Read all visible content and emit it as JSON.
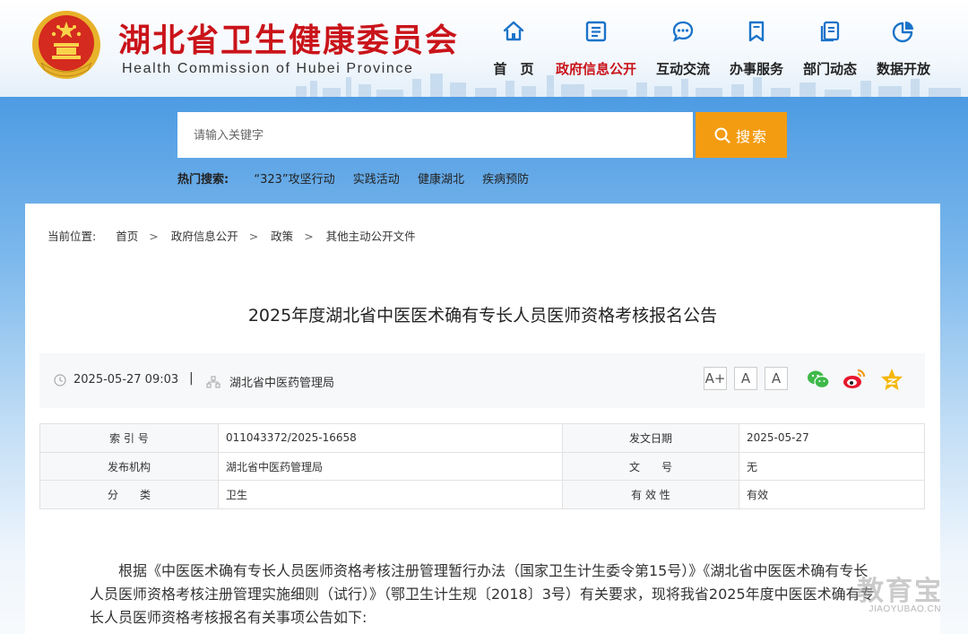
{
  "header": {
    "title": "湖北省卫生健康委员会",
    "subtitle": "Health Commission of Hubei Province"
  },
  "nav": [
    {
      "label": "首　页",
      "icon": "home-icon"
    },
    {
      "label": "政府信息公开",
      "icon": "document-list-icon",
      "active": true
    },
    {
      "label": "互动交流",
      "icon": "chat-bubble-icon"
    },
    {
      "label": "办事服务",
      "icon": "bookmark-icon"
    },
    {
      "label": "部门动态",
      "icon": "copy-document-icon"
    },
    {
      "label": "数据开放",
      "icon": "pie-chart-icon"
    }
  ],
  "search": {
    "placeholder": "请输入关键字",
    "button_label": "搜索"
  },
  "hot_search": {
    "label": "热门搜索:",
    "items": [
      "“323”攻坚行动",
      "实践活动",
      "健康湖北",
      "疾病预防"
    ]
  },
  "breadcrumb": {
    "label": "当前位置:",
    "items": [
      "首页",
      "政府信息公开",
      "政策",
      "其他主动公开文件"
    ],
    "separator": ">"
  },
  "article": {
    "title": "2025年度湖北省中医医术确有专长人员医师资格考核报名公告",
    "datetime": "2025-05-27 09:03",
    "meta_separator": "|",
    "source": "湖北省中医药管理局",
    "font_sizes": [
      "A+",
      "A",
      "A"
    ],
    "share": [
      "wechat-icon",
      "weibo-icon",
      "qzone-icon"
    ]
  },
  "info": {
    "index_label": "索 引 号",
    "index_value": "011043372/2025-16658",
    "date_label": "发文日期",
    "date_value": "2025-05-27",
    "org_label": "发布机构",
    "org_value": "湖北省中医药管理局",
    "docno_label": "文　　号",
    "docno_value": "无",
    "category_label": "分　　类",
    "category_value": "卫生",
    "validity_label": "有 效 性",
    "validity_value": "有效"
  },
  "body": {
    "paragraph": "根据《中医医术确有专长人员医师资格考核注册管理暂行办法（国家卫生计生委令第15号）》《湖北省中医医术确有专长人员医师资格考核注册管理实施细则（试行）》（鄂卫生计生规〔2018〕3号）有关要求，现将我省2025年度中医医术确有专长人员医师资格考核报名有关事项公告如下:"
  },
  "watermark": {
    "main": "教育宝",
    "sub": "JIAOYUBAO.CN"
  },
  "colors": {
    "brand_red": "#c9141a",
    "search_orange": "#f39c12",
    "nav_icon_blue": "#1a73c9"
  }
}
